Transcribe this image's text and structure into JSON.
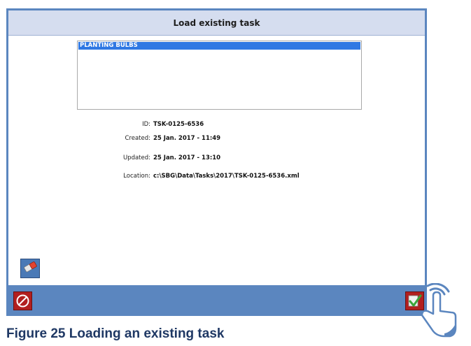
{
  "dialog": {
    "title": "Load existing task",
    "tasks": [
      "PLANTING BULBS"
    ],
    "details": {
      "id_label": "ID:",
      "id_value": "TSK-0125-6536",
      "created_label": "Created:",
      "created_value": "25 Jan. 2017 - 11:49",
      "updated_label": "Updated:",
      "updated_value": "25 Jan. 2017 - 13:10",
      "location_label": "Location:",
      "location_value": "c:\\SBG\\Data\\Tasks\\2017\\TSK-0125-6536.xml"
    },
    "icons": {
      "erase": "eraser-icon",
      "cancel": "cancel-icon",
      "confirm": "checkmark-icon"
    }
  },
  "caption": "Figure 25 Loading an existing task",
  "colors": {
    "frame": "#5b86bf",
    "titlebar": "#d5ddef",
    "selection": "#2f78e3",
    "button_red": "#b21f1f",
    "caption": "#1f3864"
  }
}
